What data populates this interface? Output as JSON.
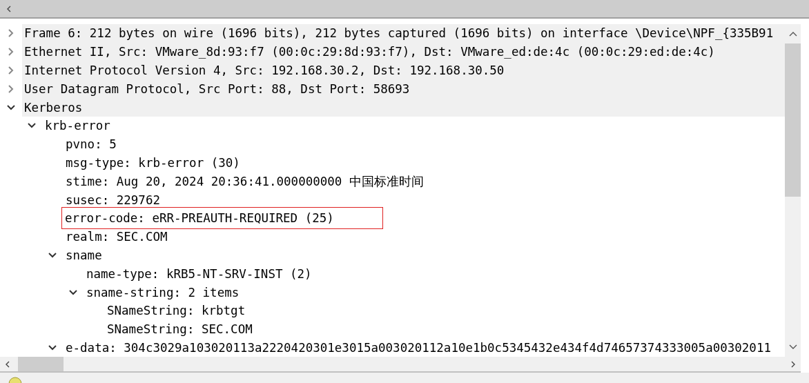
{
  "tree": [
    {
      "label": "Frame 6: 212 bytes on wire (1696 bits), 212 bytes captured (1696 bits) on interface \\Device\\NPF_{335B91",
      "expanded": false
    },
    {
      "label": "Ethernet II, Src: VMware_8d:93:f7 (00:0c:29:8d:93:f7), Dst: VMware_ed:de:4c (00:0c:29:ed:de:4c)",
      "expanded": false
    },
    {
      "label": "Internet Protocol Version 4, Src: 192.168.30.2, Dst: 192.168.30.50",
      "expanded": false
    },
    {
      "label": "User Datagram Protocol, Src Port: 88, Dst Port: 58693",
      "expanded": false
    },
    {
      "label": "Kerberos",
      "expanded": true,
      "children": [
        {
          "label": "krb-error",
          "expanded": true,
          "children": [
            {
              "label": "pvno: 5"
            },
            {
              "label": "msg-type: krb-error (30)"
            },
            {
              "label": "stime: Aug 20, 2024 20:36:41.000000000 中国标准时间"
            },
            {
              "label": "susec: 229762"
            },
            {
              "label": "error-code: eRR-PREAUTH-REQUIRED (25)",
              "highlighted": true
            },
            {
              "label": "realm: SEC.COM"
            },
            {
              "label": "sname",
              "expanded": true,
              "children": [
                {
                  "label": "name-type: kRB5-NT-SRV-INST (2)"
                },
                {
                  "label": "sname-string: 2 items",
                  "expanded": true,
                  "children": [
                    {
                      "label": "SNameString: krbtgt"
                    },
                    {
                      "label": "SNameString: SEC.COM"
                    }
                  ]
                }
              ]
            },
            {
              "label": "e-data: 304c3029a103020113a2220420301e3015a003020112a10e1b0c5345432e434f4d74657374333005a00302011",
              "expanded": true
            }
          ]
        }
      ]
    }
  ]
}
